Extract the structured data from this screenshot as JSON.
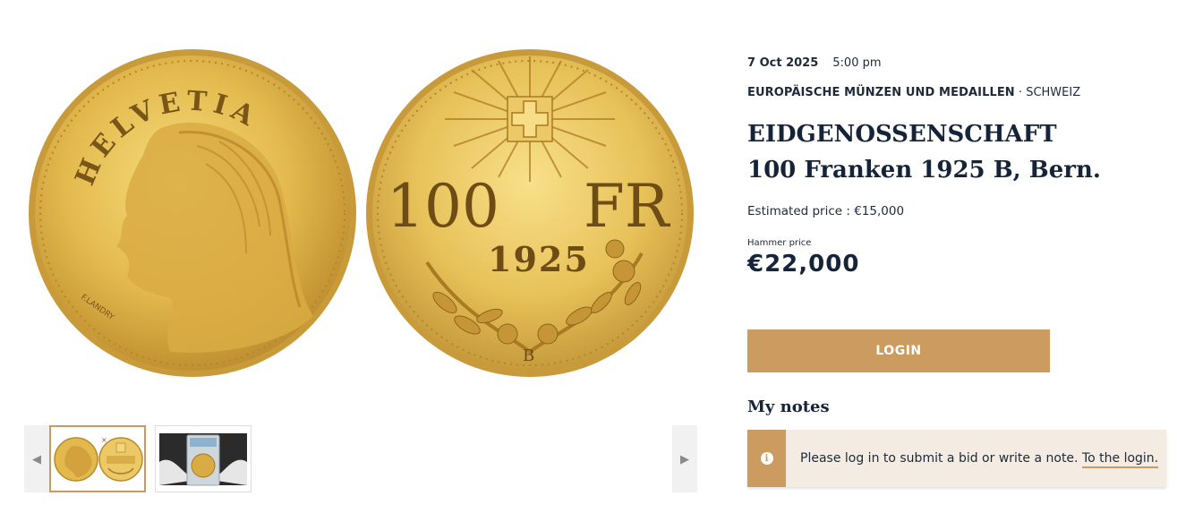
{
  "gallery": {
    "obverse_legend": "HELVETIA",
    "obverse_signature": "F.LANDRY",
    "reverse_value": "100",
    "reverse_unit": "FR",
    "reverse_year": "1925",
    "reverse_mintmark": "B",
    "thumbnails": [
      {
        "name": "coin-pair-thumbnail"
      },
      {
        "name": "slab-photo-thumbnail"
      }
    ]
  },
  "lot": {
    "date": "7 Oct 2025",
    "time": "5:00 pm",
    "category_main": "EUROPÄISCHE MÜNZEN UND MEDAILLEN",
    "category_separator": " · ",
    "category_sub": "SCHWEIZ",
    "title_line1": "EIDGENOSSENSCHAFT",
    "title_line2": "100 Franken 1925 B, Bern.",
    "estimate": "Estimated price : €15,000",
    "hammer_label": "Hammer price",
    "hammer_price": "€22,000"
  },
  "actions": {
    "login_label": "LOGIN"
  },
  "notes": {
    "title": "My notes",
    "message": "Please log in to submit a bid or write a note.",
    "link_label": "To the login."
  },
  "colors": {
    "accent": "#cb9b5f",
    "notice_bg": "#f4ebe2",
    "text_dark": "#16243a",
    "gold": "#e8c45a"
  }
}
